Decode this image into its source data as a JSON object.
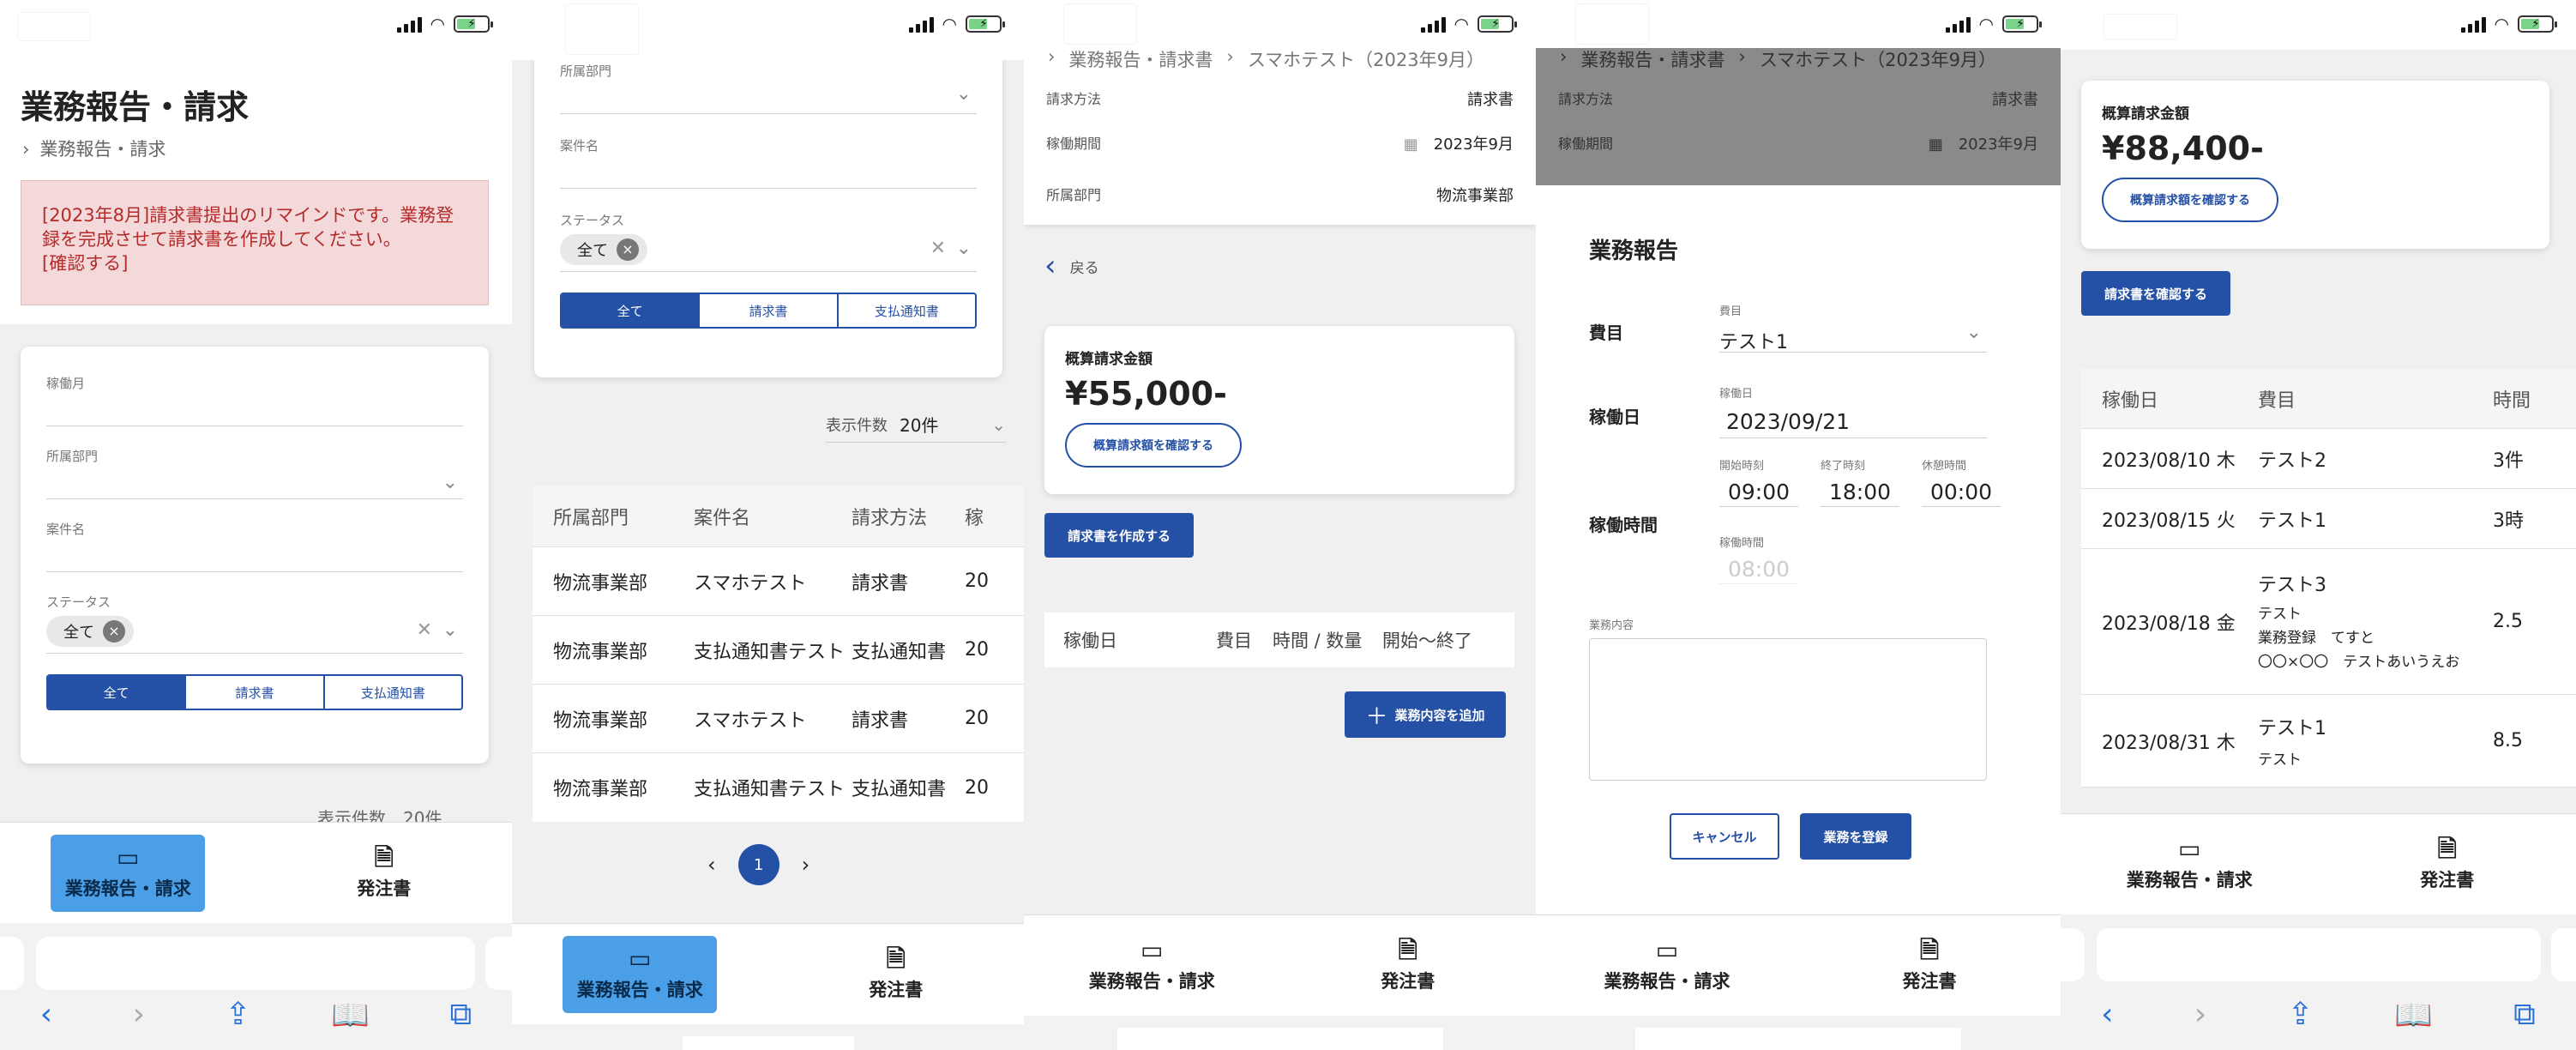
{
  "accent": "#2450a6",
  "status": {
    "icons": [
      "signal-icon",
      "wifi-icon",
      "battery-icon"
    ]
  },
  "nav": {
    "report": "業務報告・請求",
    "order": "発注書"
  },
  "s1": {
    "title": "業務報告・請求",
    "breadcrumb": "業務報告・請求",
    "alert": "[2023年8月]請求書提出のリマインドです。業務登録を完成させて請求書を作成してください。",
    "alert_link": "[確認する]",
    "f_month": "稼働月",
    "f_dept": "所属部門",
    "f_case": "案件名",
    "f_status": "ステータス",
    "chip": "全て",
    "seg": [
      "全て",
      "請求書",
      "支払通知書"
    ],
    "cut": "表示件数　20件"
  },
  "s2": {
    "f_dept": "所属部門",
    "f_case": "案件名",
    "f_status": "ステータス",
    "chip": "全て",
    "seg": [
      "全て",
      "請求書",
      "支払通知書"
    ],
    "count_label": "表示件数",
    "count_value": "20件",
    "headers": [
      "所属部門",
      "案件名",
      "請求方法",
      "稼"
    ],
    "rows": [
      [
        "物流事業部",
        "スマホテスト",
        "請求書",
        "20"
      ],
      [
        "物流事業部",
        "支払通知書テスト",
        "支払通知書",
        "20"
      ],
      [
        "物流事業部",
        "スマホテスト",
        "請求書",
        "20"
      ],
      [
        "物流事業部",
        "支払通知書テスト",
        "支払通知書",
        "20"
      ]
    ],
    "page": "1"
  },
  "s3": {
    "breadcrumb": [
      "業務報告・請求書",
      "スマホテスト（2023年9月）"
    ],
    "info": [
      [
        "請求方法",
        "請求書"
      ],
      [
        "稼働期間",
        "2023年9月"
      ],
      [
        "所属部門",
        "物流事業部"
      ]
    ],
    "back": "戻る",
    "amount_label": "概算請求金額",
    "amount": "¥55,000-",
    "confirm": "概算請求額を確認する",
    "create": "請求書を作成する",
    "headers": [
      "稼働日",
      "費目",
      "時間 / 数量",
      "開始～終了"
    ],
    "add": "業務内容を追加"
  },
  "s4": {
    "breadcrumb": [
      "業務報告・請求書",
      "スマホテスト（2023年9月）"
    ],
    "info": [
      [
        "請求方法",
        "請求書"
      ],
      [
        "稼働期間",
        "2023年9月"
      ]
    ],
    "modal_title": "業務報告",
    "k_item": "費目",
    "item_small": "費目",
    "item_value": "テスト1",
    "k_date": "稼働日",
    "date_small": "稼働日",
    "date_value": "2023/09/21",
    "k_time": "稼働時間",
    "start_l": "開始時刻",
    "start_v": "09:00",
    "end_l": "終了時刻",
    "end_v": "18:00",
    "break_l": "休憩時間",
    "break_v": "00:00",
    "work_l": "稼働時間",
    "work_v": "08:00",
    "content_l": "業務内容",
    "cancel": "キャンセル",
    "submit": "業務を登録"
  },
  "s5": {
    "amount_label": "概算請求金額",
    "amount": "¥88,400-",
    "confirm": "概算請求額を確認する",
    "invoice": "請求書を確認する",
    "headers": [
      "稼働日",
      "費目",
      "時間"
    ],
    "rows": [
      {
        "date": "2023/08/10 木",
        "item": "テスト2",
        "sub": "",
        "val": "3件"
      },
      {
        "date": "2023/08/15 火",
        "item": "テスト1",
        "sub": "",
        "val": "3時"
      },
      {
        "date": "2023/08/18 金",
        "item": "テスト3",
        "sub": "テスト\n業務登録　てすと\n〇〇×〇〇　テストあいうえお",
        "val": "2.5"
      },
      {
        "date": "2023/08/31 木",
        "item": "テスト1",
        "sub": "テスト",
        "val": "8.5"
      }
    ]
  }
}
